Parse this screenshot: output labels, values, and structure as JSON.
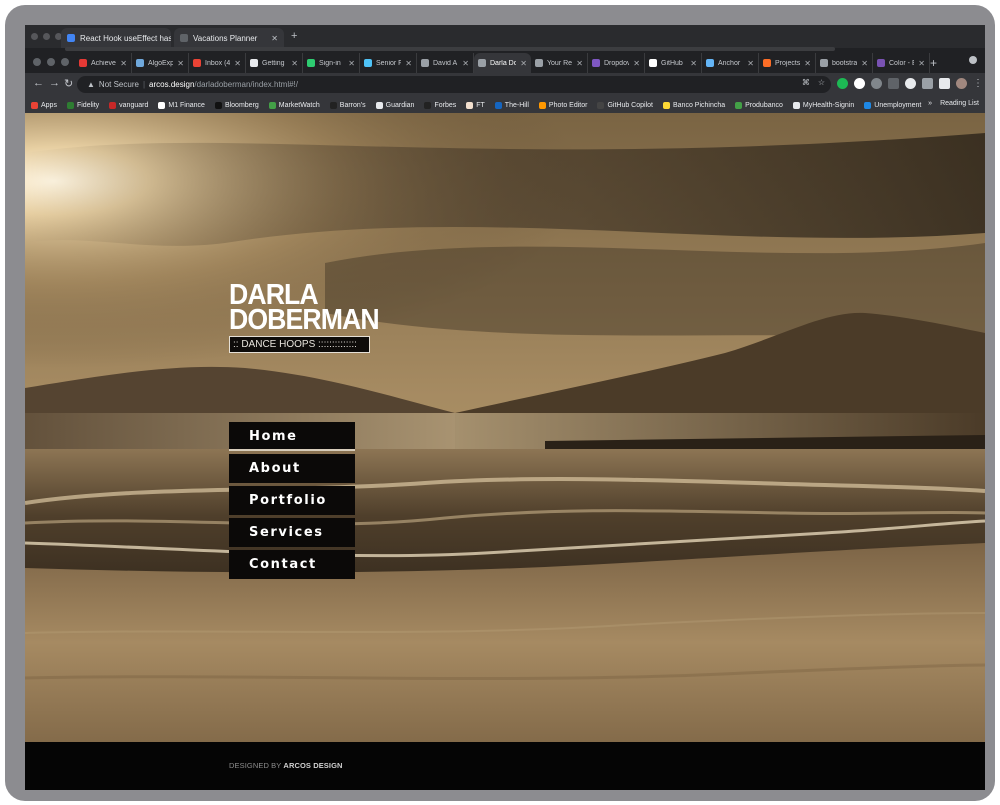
{
  "back_window": {
    "tabs": [
      {
        "title": "React Hook useEffect has mis",
        "favicon_color": "#4285f4"
      },
      {
        "title": "Vacations Planner",
        "favicon_color": "#5f6368"
      }
    ]
  },
  "tabs": [
    {
      "title": "Achieve",
      "favicon_color": "#e53935"
    },
    {
      "title": "AlgoExp",
      "favicon_color": "#6fa8dc"
    },
    {
      "title": "Inbox (4",
      "favicon_color": "#ea4335"
    },
    {
      "title": "Getting",
      "favicon_color": "#e8eaed"
    },
    {
      "title": "Sign-in",
      "favicon_color": "#2ecc71"
    },
    {
      "title": "Senior F",
      "favicon_color": "#4fc3f7"
    },
    {
      "title": "David A",
      "favicon_color": "#9aa0a6"
    },
    {
      "title": "Darla Do",
      "favicon_color": "#9aa0a6",
      "active": true
    },
    {
      "title": "Your Re",
      "favicon_color": "#9aa0a6"
    },
    {
      "title": "Dropdov",
      "favicon_color": "#7e57c2"
    },
    {
      "title": "GitHub",
      "favicon_color": "#ffffff"
    },
    {
      "title": "Anchor",
      "favicon_color": "#64b5f6"
    },
    {
      "title": "Projects",
      "favicon_color": "#fc6d26"
    },
    {
      "title": "bootstra",
      "favicon_color": "#9aa0a6"
    },
    {
      "title": "Color - E",
      "favicon_color": "#7952b3"
    }
  ],
  "address_bar": {
    "security_label": "Not Secure",
    "host": "arcos.design",
    "path": "/darladoberman/index.html#!/"
  },
  "bookmarks": [
    {
      "label": "Apps",
      "color": "#ea4335"
    },
    {
      "label": "Fidelity",
      "color": "#2e7d32"
    },
    {
      "label": "vanguard",
      "color": "#c62828"
    },
    {
      "label": "M1 Finance",
      "color": "#ffffff"
    },
    {
      "label": "Bloomberg",
      "color": "#111111"
    },
    {
      "label": "MarketWatch",
      "color": "#43a047"
    },
    {
      "label": "Barron's",
      "color": "#222222"
    },
    {
      "label": "Guardian",
      "color": "#e8eaed"
    },
    {
      "label": "Forbes",
      "color": "#222222"
    },
    {
      "label": "FT",
      "color": "#f2dfce"
    },
    {
      "label": "The-Hill",
      "color": "#1565c0"
    },
    {
      "label": "Photo Editor",
      "color": "#ff9800"
    },
    {
      "label": "GitHub Copilot",
      "color": "#444444"
    },
    {
      "label": "Banco Pichincha",
      "color": "#fdd835"
    },
    {
      "label": "Produbanco",
      "color": "#43a047"
    },
    {
      "label": "MyHealth-Signin",
      "color": "#e8eaed"
    },
    {
      "label": "Unemployment",
      "color": "#1e88e5"
    }
  ],
  "bookmarks_overflow": "»",
  "reading_list": "Reading List",
  "site": {
    "brand_line1": "DARLA",
    "brand_line2": "DOBERMAN",
    "tagline": ":: DANCE HOOPS ::::::::::::::",
    "nav": [
      {
        "label": "Home",
        "current": true
      },
      {
        "label": "About"
      },
      {
        "label": "Portfolio"
      },
      {
        "label": "Services"
      },
      {
        "label": "Contact"
      }
    ],
    "footer_prefix": "DESIGNED BY",
    "footer_brand": "ARCOS DESIGN"
  },
  "colors": {
    "sepia_sky": "#d9bf92",
    "sepia_dark": "#2d2417",
    "nav_bg": "#0b0908"
  }
}
